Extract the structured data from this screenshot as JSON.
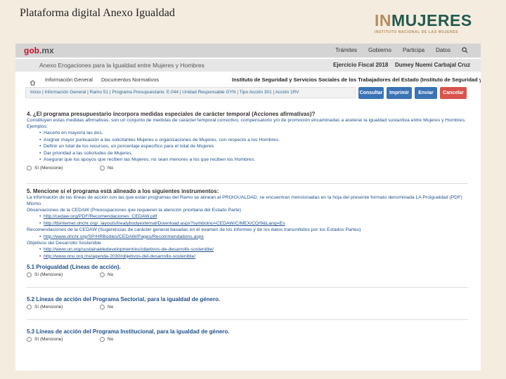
{
  "slide": {
    "title": "Plataforma digital Anexo Igualdad"
  },
  "logo": {
    "part1": "IN",
    "part2": "MUJERES",
    "subtitle": "INSTITUTO NACIONAL DE LAS MUJERES"
  },
  "gob": {
    "logo_main": "gob",
    "logo_suffix": ".mx",
    "nav": [
      "Trámites",
      "Gobierno",
      "Participa",
      "Datos"
    ]
  },
  "app": {
    "title": "Anexo Erogaciones para la Igualdad entre Mujeres y Hombres",
    "fiscal_year": "Ejercicio Fiscal 2018",
    "user": "Dumey Nuemi Carbajal Cruz"
  },
  "toolbar": {
    "tab_general": "Información General",
    "tab_documents": "Documentos Normativos",
    "institution": "Instituto de Seguridad y Servicios Sociales de los Trabajadores del Estado (Instituto de Seguridad y S..."
  },
  "breadcrumb": "Inicio  |  Información General  |  Ramo 51  |  Programa Presupuestario: E.044  |  Unidad Responsable GYN  |  Tipo Acción 301  |  Acción 1RV",
  "buttons": {
    "b1": "Consultar",
    "b2": "Imprimir",
    "b3": "Enviar",
    "b4": "Cancelar"
  },
  "q4": {
    "title": "4. ¿El programa presupuestario incorpora medidas especiales de carácter temporal (Acciones afirmativas)?",
    "intro": "Constituyen estas medidas afirmativas, son un conjunto de medidas de carácter temporal correctivo, compensatorio y/o de promoción encaminadas a acelerar la igualdad sustantiva entre Mujeres y Hombres. Ejemplos:",
    "bullets": [
      "Hacerlo en mayoría las dos.",
      "Asignar mayor puntuación a las solicitantes Mujeres u organizaciones de Mujeres, con respecto a los Hombres.",
      "Definir un total de los recursos, un porcentaje específico para el total de Mujeres",
      "Dar prioridad a las solicitudes de Mujeres.",
      "Asegurar que los apoyos que reciben las Mujeres, no sean menores a los que reciben los Hombres."
    ],
    "yes": "Sí (Mencione)",
    "no": "No"
  },
  "q5": {
    "title": "5. Mencione si el programa está alineado a los siguientes instrumentos:",
    "intro": "La información de las líneas de acción con las que están programas del Ramo se alinean al PROIGUALDAD, se encuentran mencionadas en la hoja del presente formato denominada LA Proigualdad (PDF) Mismo",
    "obs_label": "Observaciones de la CEDAW (Preocupaciones que requieren la atención prioritaria del Estado Parte)",
    "obs_links": [
      "http://cedaw.org/PDF/Recomendaciones_CEDAW.pdf",
      "http://tbinternet.ohchr.org/_layouts/treatybodyexternal/Download.aspx?symbolno=CEDAW/C/MEX/CO/9&Lang=Es"
    ],
    "rec_label": "Recomendaciones de la CEDAW (Sugerencias de carácter general basadas en el examen de los informes y de los datos transmitidos por los Estados Partes)",
    "rec_links": [
      "http://www.ohchr.org/SP/HRBodies/CEDAW/Pages/Recommendations.aspx"
    ],
    "ods_label": "Objetivos del Desarrollo Sostenible",
    "ods_links": [
      "http://www.un.org/sustainabledevelopment/es/objetivos-de-desarrollo-sostenible/",
      "http://www.onu.org.mx/agenda-2030/objetivos-del-desarrollo-sostenible/"
    ]
  },
  "q51": {
    "title": "5.1 Proigualdad (Líneas de acción).",
    "yes": "Sí (Mencione)",
    "no": "No"
  },
  "q52": {
    "title": "5.2 Líneas de acción del Programa Sectorial, para la igualdad de género.",
    "yes": "Sí (Mencione)",
    "no": "No"
  },
  "q53": {
    "title": "5.3 Líneas de acción del Programa Institucional, para la igualdad de género.",
    "yes": "Sí (Mencione)",
    "no": "No"
  },
  "colors": {
    "gold": "#b38e5d",
    "green": "#235b4e",
    "gob_red": "#c8102e",
    "link_blue": "#1f4f8a",
    "btn_blue": "#3a73b6",
    "btn_red": "#d9534f"
  }
}
